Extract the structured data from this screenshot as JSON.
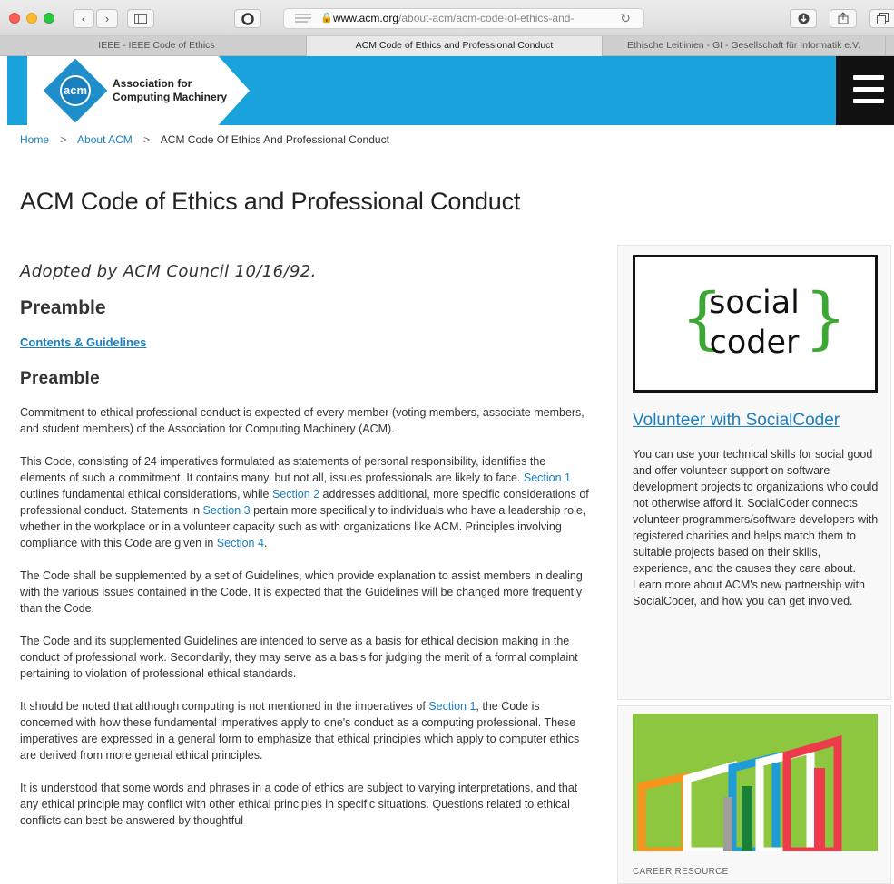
{
  "browser": {
    "url_host": "www.acm.org",
    "url_path": "/about-acm/acm-code-of-ethics-and-",
    "tabs": [
      {
        "label": "IEEE - IEEE Code of Ethics",
        "active": false
      },
      {
        "label": "ACM Code of Ethics and Professional Conduct",
        "active": true
      },
      {
        "label": "Ethische Leitlinien - GI - Gesellschaft für Informatik e.V.",
        "active": false
      }
    ]
  },
  "header": {
    "logo_mark": "acm",
    "logo_text_line1": "Association for",
    "logo_text_line2": "Computing Machinery",
    "menu_icon": "hamburger-menu-icon",
    "color": "#1aa2dc"
  },
  "breadcrumb": {
    "home": "Home",
    "about": "About ACM",
    "current": "ACM Code Of Ethics And Professional Conduct",
    "separator": ">"
  },
  "page": {
    "title": "ACM Code of Ethics and Professional Conduct",
    "adopted": "Adopted by ACM Council 10/16/92.",
    "heading_1": "Preamble",
    "contents_link": "Contents & Guidelines",
    "heading_2": "Preamble"
  },
  "content": {
    "p1": "Commitment to ethical professional conduct is expected of every member (voting members, associate members, and student members) of the Association for Computing Machinery (ACM).",
    "p2_a": "This Code, consisting of 24 imperatives formulated as statements of personal responsibility, identifies the elements of such a commitment. It contains many, but not all, issues professionals are likely to face. ",
    "p2_link1": "Section 1",
    "p2_b": " outlines fundamental ethical considerations, while ",
    "p2_link2": "Section 2",
    "p2_c": " addresses additional, more specific considerations of professional conduct. Statements in ",
    "p2_link3": "Section 3",
    "p2_d": " pertain more specifically to individuals who have a leadership role, whether in the workplace or in a volunteer capacity such as with organizations like ACM. Principles involving compliance with this Code are given in ",
    "p2_link4": "Section 4",
    "p2_e": ".",
    "p3": "The Code shall be supplemented by a set of Guidelines, which provide explanation to assist members in dealing with the various issues contained in the Code. It is expected that the Guidelines will be changed more frequently than the Code.",
    "p4": "The Code and its supplemented Guidelines are intended to serve as a basis for ethical decision making in the conduct of professional work. Secondarily, they may serve as a basis for judging the merit of a formal complaint pertaining to violation of professional ethical standards.",
    "p5_a": "It should be noted that although computing is not mentioned in the imperatives of ",
    "p5_link": "Section 1",
    "p5_b": ", the Code is concerned with how these fundamental imperatives apply to one's conduct as a computing professional. These imperatives are expressed in a general form to emphasize that ethical principles which apply to computer ethics are derived from more general ethical principles.",
    "p6": "It is understood that some words and phrases in a code of ethics are subject to varying interpretations, and that any ethical principle may conflict with other ethical principles in specific situations. Questions related to ethical conflicts can best be answered by thoughtful"
  },
  "sidebar": {
    "socialcoder_word1": "social",
    "socialcoder_word2": "coder",
    "card_title": "Volunteer with SocialCoder",
    "card_text": "You can use your technical skills for social good and offer volunteer support on software development projects to organizations who could not otherwise afford it. SocialCoder connects volunteer programmers/software developers with registered charities and helps match them to suitable projects based on their skills, experience, and the causes they care about. Learn more about ACM's new partnership with SocialCoder, and how you can get involved.",
    "career_label": "CAREER RESOURCE",
    "brace_color": "#3aa832",
    "career_bg_color": "#8dc63f"
  }
}
